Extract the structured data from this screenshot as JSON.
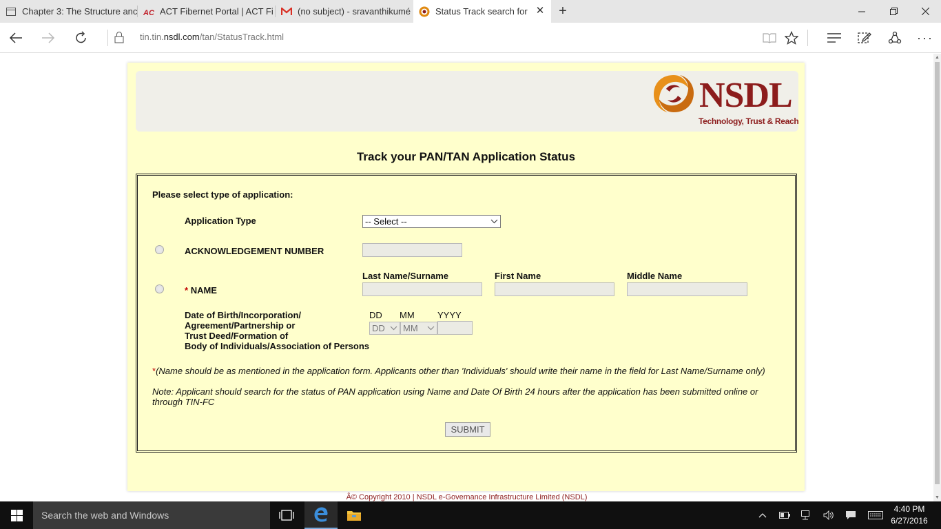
{
  "browser": {
    "tabs": [
      {
        "label": "Chapter 3: The Structure anc",
        "icon": "page-icon"
      },
      {
        "label": "ACT Fibernet Portal | ACT Fi",
        "icon": "act-icon"
      },
      {
        "label": "(no subject) - sravanthikumé",
        "icon": "gmail-icon"
      },
      {
        "label": "Status Track search for F",
        "icon": "nsdl-icon"
      }
    ],
    "url_prefix": "tin.tin.",
    "url_domain": "nsdl.com",
    "url_path": "/tan/StatusTrack.html"
  },
  "page": {
    "logo_text": "NSDL",
    "logo_tagline": "Technology, Trust & Reach",
    "title": "Track your PAN/TAN Application Status",
    "select_type_label": "Please select type of application:",
    "application_type_label": "Application Type",
    "application_type_value": "-- Select --",
    "ack_label": "ACKNOWLEDGEMENT NUMBER",
    "name_required_mark": "*",
    "name_label": "NAME",
    "last_name_label": "Last Name/Surname",
    "first_name_label": "First Name",
    "middle_name_label": "Middle Name",
    "dob_label_1": "Date of Birth/Incorporation/",
    "dob_label_2": "Agreement/Partnership or",
    "dob_label_3": "Trust Deed/Formation of",
    "dob_label_4": "Body of Individuals/Association of Persons",
    "dd_label": "DD",
    "mm_label": "MM",
    "yyyy_label": "YYYY",
    "dd_value": "DD",
    "mm_value": "MM",
    "name_note_mark": "*",
    "name_note": "(Name should be as mentioned in the application form. Applicants other than 'Individuals' should write their name in the field for Last Name/Surname only)",
    "search_note": "Note: Applicant should search for the status of PAN application using Name and Date Of Birth 24 hours after the application has been submitted online or through TIN-FC",
    "submit_label": "SUBMIT",
    "copyright": "Â© Copyright 2010  |  NSDL e-Governance Infrastructure Limited (NSDL)"
  },
  "taskbar": {
    "search_placeholder": "Search the web and Windows",
    "time": "4:40 PM",
    "date": "6/27/2016"
  },
  "colors": {
    "brand": "#8c1c1c",
    "page_bg": "#ffffcc",
    "taskbar": "#101010"
  }
}
